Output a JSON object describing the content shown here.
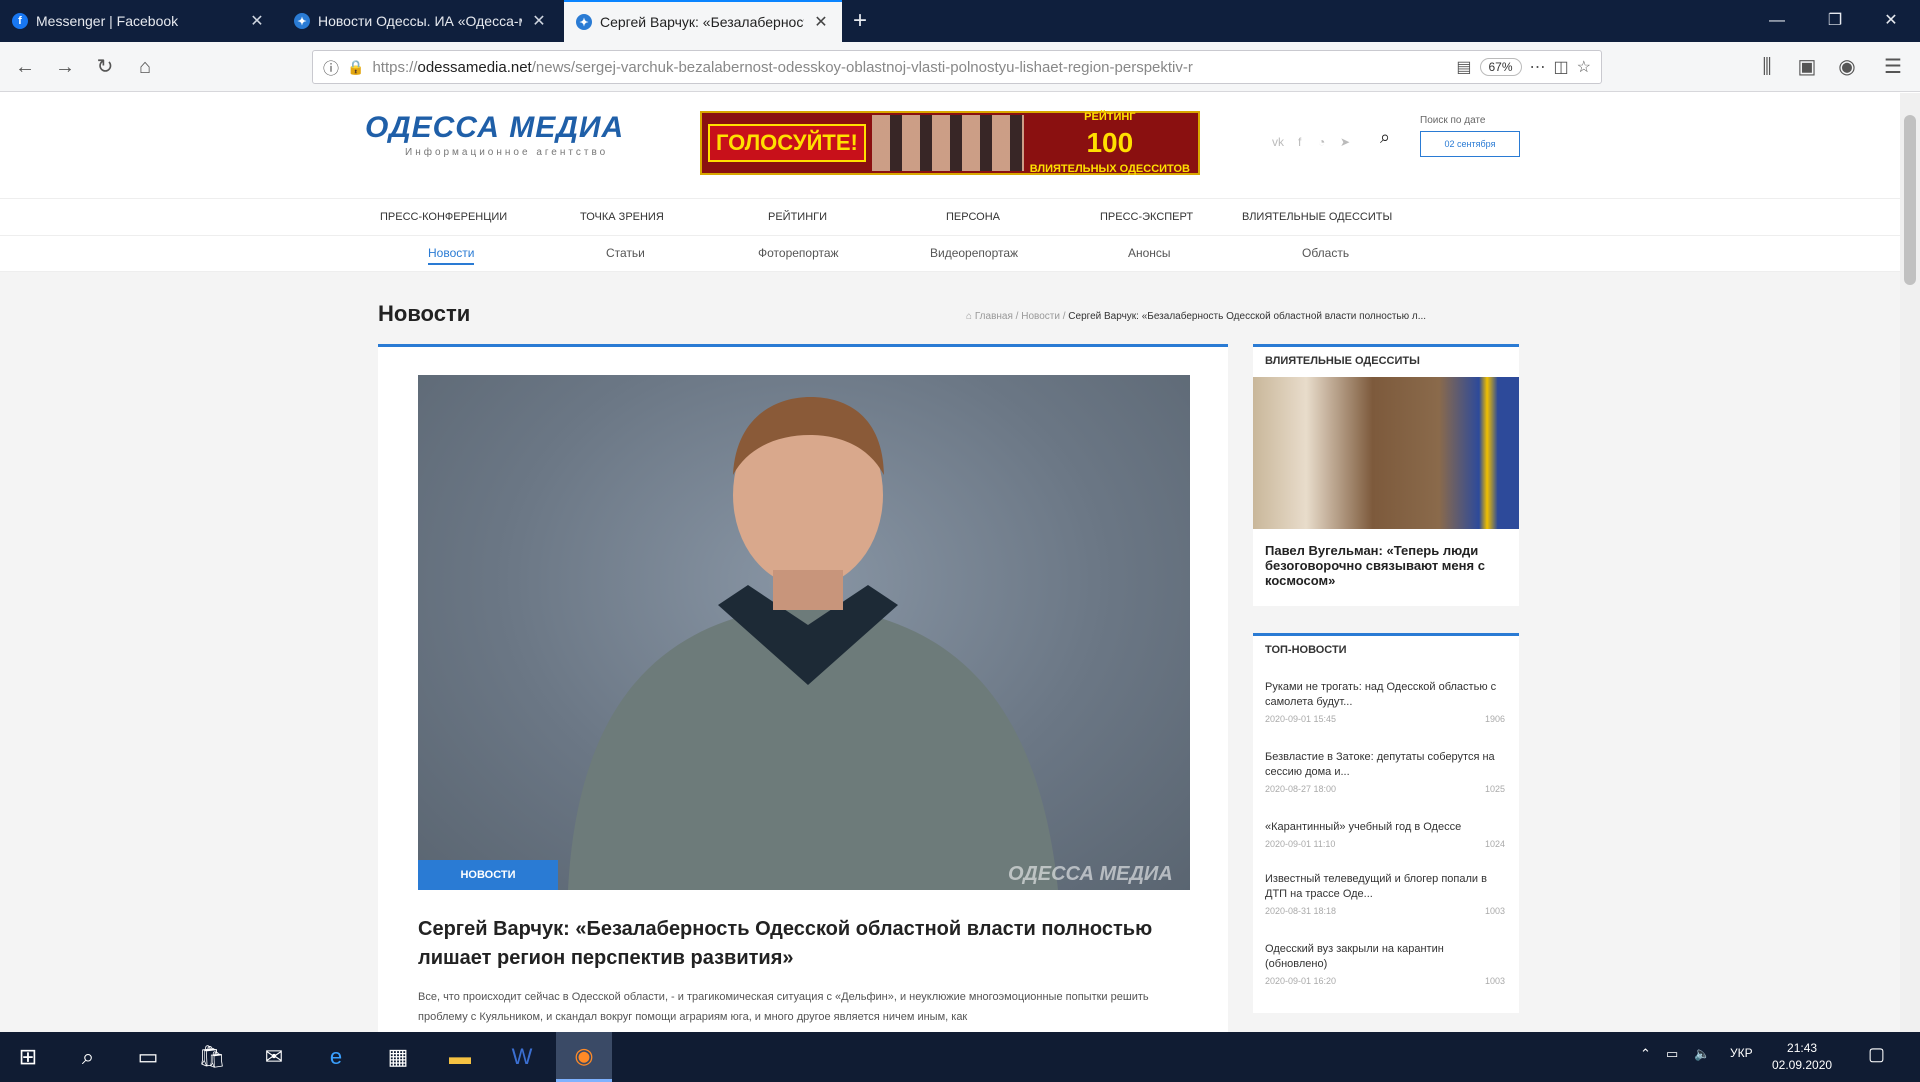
{
  "browser": {
    "tabs": [
      {
        "title": "Messenger | Facebook",
        "favicon_color": "#1877f2",
        "favicon_glyph": "f"
      },
      {
        "title": "Новости Одессы. ИА «Одесса-медиа»",
        "favicon_color": "#2a7bd4",
        "favicon_glyph": "✦"
      },
      {
        "title": "Сергей Варчук: «Безалаберность Одесской",
        "favicon_color": "#2a7bd4",
        "favicon_glyph": "✦"
      }
    ],
    "url_prefix": "https://",
    "url_domain": "odessamedia.net",
    "url_path": "/news/sergej-varchuk-bezalabernost-odesskoy-oblastnoj-vlasti-polnostyu-lishaet-region-perspektiv-r",
    "zoom": "67%"
  },
  "site": {
    "logo_text": "ОДЕССА МЕДИА",
    "logo_subtitle": "Информационное агентство",
    "banner": {
      "left": "ГОЛОСУЙТЕ!",
      "right_top": "РЕЙТИНГ",
      "right_num": "100",
      "right_bottom": "ВЛИЯТЕЛЬНЫХ ОДЕССИТОВ"
    },
    "search_label": "Поиск по дате",
    "search_date": "02 сентября",
    "menu_top": [
      "ПРЕСС-КОНФЕРЕНЦИИ",
      "ТОЧКА ЗРЕНИЯ",
      "РЕЙТИНГИ",
      "ПЕРСОНА",
      "ПРЕСС-ЭКСПЕРТ",
      "ВЛИЯТЕЛЬНЫЕ ОДЕССИТЫ"
    ],
    "menu_sub": [
      "Новости",
      "Статьи",
      "Фоторепортаж",
      "Видеорепортаж",
      "Анонсы",
      "Область"
    ]
  },
  "page": {
    "title": "Новости",
    "breadcrumbs": [
      "Главная",
      "Новости"
    ],
    "breadcrumb_current": "Сергей Варчук: «Безалаберность Одесской областной власти полностью л...",
    "photo_badge": "НОВОСТИ",
    "photo_watermark": "ОДЕССА МЕДИА",
    "headline": "Сергей Варчук: «Безалаберность Одесской областной власти полностью лишает регион перспектив развития»",
    "lede": "Все, что происходит сейчас в Одесской области, - и трагикомическая ситуация с «Дельфин», и неуклюжие многоэмоционные попытки решить проблему с Куяльником, и скандал вокруг помощи аграриям юга, и много другое является ничем иным, как"
  },
  "sidebar": {
    "influential_header": "ВЛИЯТЕЛЬНЫЕ ОДЕССИТЫ",
    "influential_caption": "Павел Вугельман: «Теперь люди безоговорочно связывают меня с космосом»",
    "top_header": "ТОП-НОВОСТИ",
    "top_news": [
      {
        "title": "Руками не трогать: над Одесской областью с самолета будут...",
        "date": "2020-09-01 15:45",
        "views": "1906"
      },
      {
        "title": "Безвластие в Затоке: депутаты соберутся на сессию дома и...",
        "date": "2020-08-27 18:00",
        "views": "1025"
      },
      {
        "title": "«Карантинный» учебный год в Одессе",
        "date": "2020-09-01 11:10",
        "views": "1024"
      },
      {
        "title": "Известный телеведущий и блогер попали в ДТП на трассе Оде...",
        "date": "2020-08-31 18:18",
        "views": "1003"
      },
      {
        "title": "Одесский вуз закрыли на карантин (обновлено)",
        "date": "2020-09-01 16:20",
        "views": "1003"
      }
    ]
  },
  "taskbar": {
    "lang": "УКР",
    "time": "21:43",
    "date": "02.09.2020"
  }
}
